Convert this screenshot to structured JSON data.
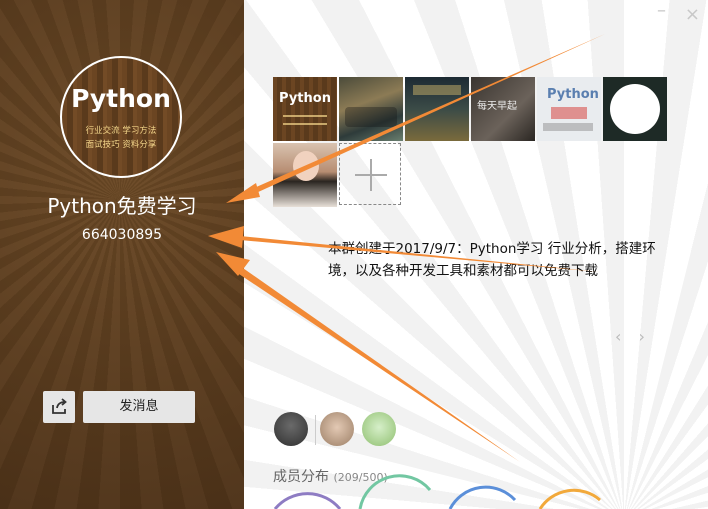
{
  "group": {
    "avatar_title": "Python",
    "avatar_line1": "行业交流  学习方法",
    "avatar_line2": "面试技巧  资料分享",
    "name": "Python免费学习",
    "id": "664030895"
  },
  "buttons": {
    "send_message": "发消息"
  },
  "gallery": {
    "thumb1_text": "Python",
    "thumb4_text": "每天早起",
    "thumb5_text": "Python"
  },
  "description": "本群创建于2017/9/7：Python学习       行业分析，搭建环境，以及各种开发工具和素材都可以免费下载",
  "pager": "‹ ›",
  "members": {
    "distribution_label": "成员分布",
    "count": "(209/500)"
  },
  "colors": {
    "arrow": "#f28a36",
    "wood_dark": "#5a3c1e"
  }
}
